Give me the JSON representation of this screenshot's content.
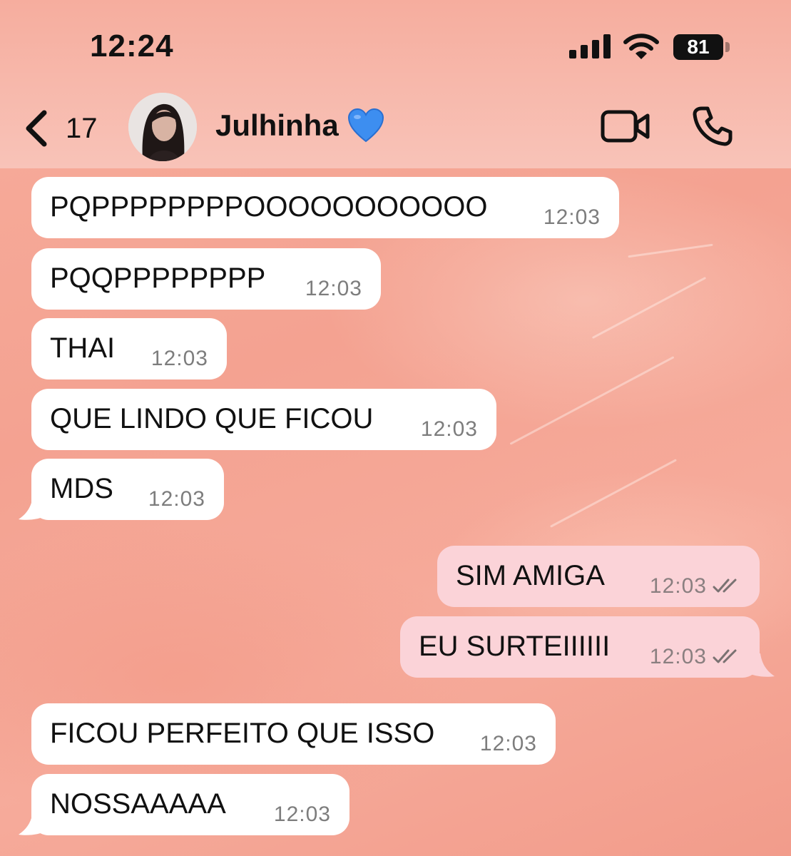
{
  "status_bar": {
    "time": "12:24",
    "battery": "81",
    "signal_icon": "signal-bars-icon",
    "wifi_icon": "wifi-icon"
  },
  "header": {
    "back_count": "17",
    "contact_name": "Julhinha",
    "name_emoji": "blue-heart-icon",
    "video_icon": "video-camera-icon",
    "call_icon": "phone-icon"
  },
  "colors": {
    "wallpaper": "#f6a898",
    "incoming_bubble": "#ffffff",
    "outgoing_bubble": "#fbd3d8"
  },
  "messages": [
    {
      "direction": "in",
      "text": "PQPPPPPPPPOOOOOOOOOOO",
      "time": "12:03"
    },
    {
      "direction": "in",
      "text": "PQQPPPPPPPP",
      "time": "12:03"
    },
    {
      "direction": "in",
      "text": "THAI",
      "time": "12:03"
    },
    {
      "direction": "in",
      "text": "QUE LINDO QUE FICOU",
      "time": "12:03"
    },
    {
      "direction": "in",
      "text": "MDS",
      "time": "12:03"
    },
    {
      "direction": "out",
      "text": "SIM AMIGA",
      "time": "12:03",
      "status": "read"
    },
    {
      "direction": "out",
      "text": "EU SURTEIIIIII",
      "time": "12:03",
      "status": "read"
    },
    {
      "direction": "in",
      "text": "FICOU PERFEITO QUE ISSO",
      "time": "12:03"
    },
    {
      "direction": "in",
      "text": "NOSSAAAAA",
      "time": "12:03"
    }
  ]
}
